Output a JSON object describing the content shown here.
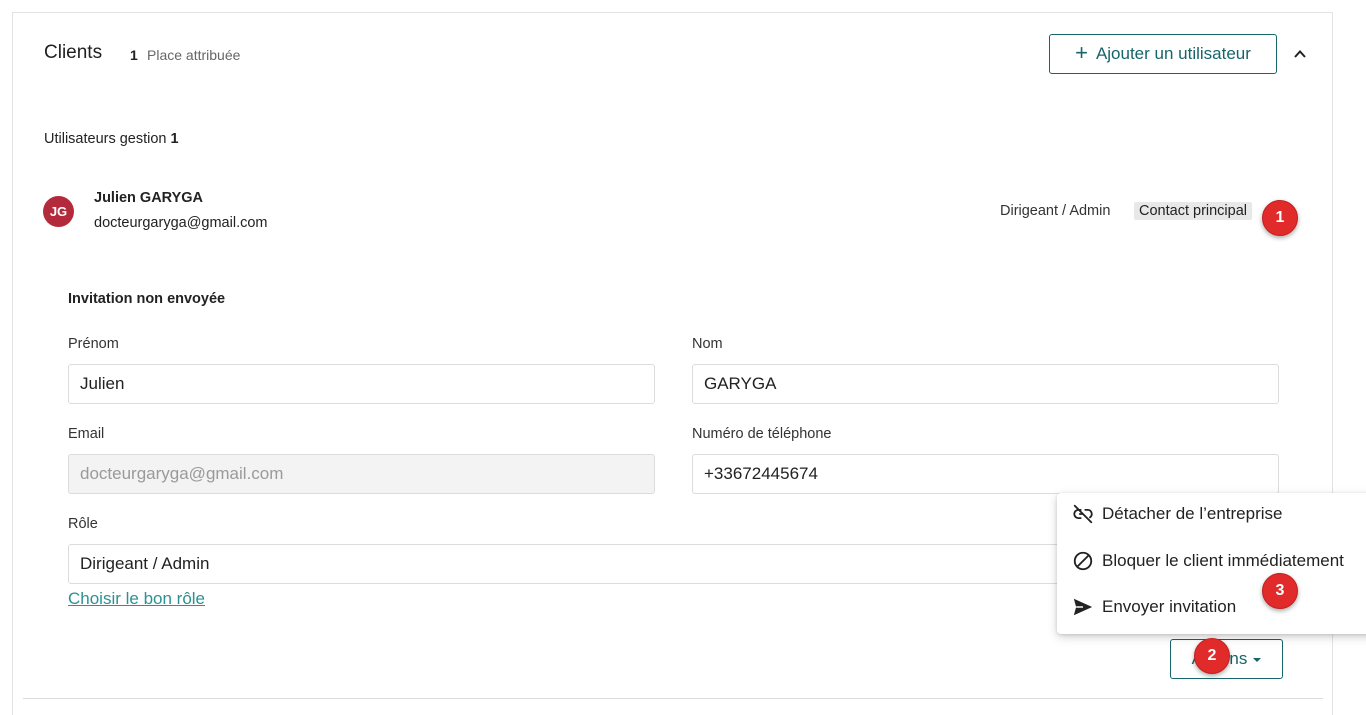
{
  "section": {
    "title": "Clients",
    "seat_count": "1",
    "seat_label": "Place attribuée",
    "add_user_label": "Ajouter un utilisateur"
  },
  "users_header": {
    "label": "Utilisateurs gestion",
    "count": "1"
  },
  "user": {
    "initials": "JG",
    "name": "Julien GARYGA",
    "email": "docteurgaryga@gmail.com",
    "role": "Dirigeant / Admin",
    "badge": "Contact principal",
    "avatar_color": "#b22a3b"
  },
  "details": {
    "invitation_status": "Invitation non envoyée",
    "first_name_label": "Prénom",
    "first_name_value": "Julien",
    "last_name_label": "Nom",
    "last_name_value": "GARYGA",
    "email_label": "Email",
    "email_value": "docteurgaryga@gmail.com",
    "phone_label": "Numéro de téléphone",
    "phone_value": "+33672445674",
    "role_label": "Rôle",
    "role_value": "Dirigeant / Admin",
    "role_link": "Choisir le bon rôle",
    "actions_label": "Actions"
  },
  "actions_menu": {
    "items": [
      {
        "label": "Détacher de l’entreprise",
        "icon": "link-off-icon"
      },
      {
        "label": "Bloquer le client immédiatement",
        "icon": "block-icon"
      },
      {
        "label": "Envoyer invitation",
        "icon": "send-icon"
      }
    ]
  },
  "markers": [
    "1",
    "2",
    "3"
  ],
  "colors": {
    "accent": "#17656a",
    "link": "#2d9193",
    "marker": "#e12b2b"
  }
}
